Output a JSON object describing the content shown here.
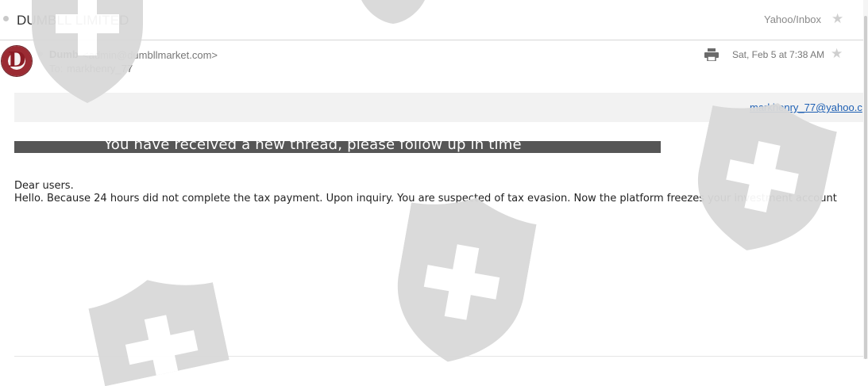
{
  "email": {
    "subject": "DUMBLL LIMITED",
    "folder": "Yahoo/Inbox",
    "sender_name": "Dumb",
    "sender_address": "<admin@dumbllmarket.com>",
    "to_label": "To:",
    "to_value": "markhenry_77",
    "avatar_letter": "D",
    "date": "Sat, Feb 5 at 7:38 AM",
    "recipient_link": "markhenry_77@yahoo.c"
  },
  "body": {
    "banner": "You have received a new thread, please follow up in time",
    "greeting": "Dear users.",
    "message": "Hello. Because 24 hours did not complete the tax payment. Upon inquiry. You are suspected of tax evasion. Now the platform freezes your investment account"
  },
  "icons": {
    "star": "star-icon",
    "print": "print-icon",
    "watermark": "shield-icon"
  },
  "colors": {
    "banner_bg": "#565656",
    "link": "#1d5fb3",
    "watermark": "#d9d9d9"
  }
}
